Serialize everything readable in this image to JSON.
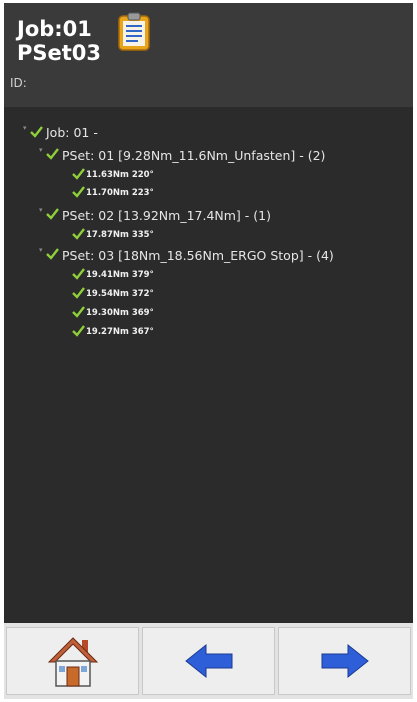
{
  "header": {
    "job": "Job:01",
    "pset": "PSet03",
    "id_label": "ID:"
  },
  "tree": {
    "job": "Job: 01 -",
    "psets": [
      {
        "label": "PSet: 01 [9.28Nm_11.6Nm_Unfasten] - (2)",
        "results": [
          "11.63Nm 220°",
          "11.70Nm 223°"
        ]
      },
      {
        "label": "PSet: 02 [13.92Nm_17.4Nm] - (1)",
        "results": [
          "17.87Nm 335°"
        ]
      },
      {
        "label": "PSet: 03 [18Nm_18.56Nm_ERGO Stop] - (4)",
        "results": [
          "19.41Nm 379°",
          "19.54Nm 372°",
          "19.30Nm 369°",
          "19.27Nm 367°"
        ]
      }
    ]
  },
  "icons": {
    "status": "checkmark-icon",
    "home": "home-icon",
    "prev": "arrow-left-icon",
    "next": "arrow-right-icon",
    "job": "clipboard-icon"
  },
  "colors": {
    "check": "#8fcf3a",
    "arrow": "#2f5fd8"
  }
}
